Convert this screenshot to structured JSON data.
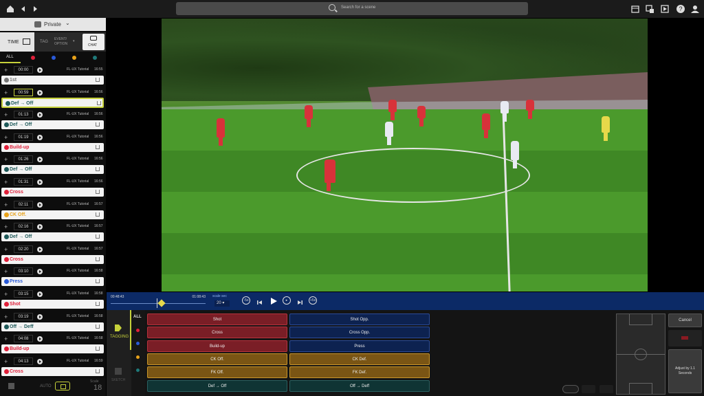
{
  "search": {
    "placeholder": "Search for a scene"
  },
  "header": {
    "icons": [
      "home-icon",
      "back-icon",
      "forward-icon",
      "calendar-icon",
      "export-icon",
      "playlist-icon",
      "help-icon",
      "account-icon"
    ]
  },
  "sidebar": {
    "visibility": "Private",
    "tabs": {
      "time": "TIME",
      "tag": "TAG",
      "event_option": "EVENT/ OPTION",
      "chat": "CHAT"
    },
    "filter_all": "ALL",
    "filter_colors": [
      "#e0203a",
      "#2a5ad8",
      "#e8a21a",
      "#1f7a7a"
    ],
    "entries": [
      {
        "time": "00:00",
        "author": "FL-UX Tutorial",
        "clock": "16:55",
        "label": "1st",
        "color": "#777777",
        "selected": false
      },
      {
        "time": "00:59",
        "author": "FL-UX Tutorial",
        "clock": "16:56",
        "label": "Def → Off",
        "color": "#1f5a5a",
        "selected": true
      },
      {
        "time": "01:13",
        "author": "FL-UX Tutorial",
        "clock": "16:56",
        "label": "Def → Off",
        "color": "#1f5a5a",
        "selected": false
      },
      {
        "time": "01:19",
        "author": "FL-UX Tutorial",
        "clock": "16:56",
        "label": "Build-up",
        "color": "#e0203a",
        "selected": false
      },
      {
        "time": "01:26",
        "author": "FL-UX Tutorial",
        "clock": "16:56",
        "label": "Def → Off",
        "color": "#1f5a5a",
        "selected": false
      },
      {
        "time": "01:31",
        "author": "FL-UX Tutorial",
        "clock": "16:56",
        "label": "Cross",
        "color": "#e0203a",
        "selected": false
      },
      {
        "time": "02:11",
        "author": "FL-UX Tutorial",
        "clock": "16:57",
        "label": "CK Off.",
        "color": "#e8a21a",
        "selected": false
      },
      {
        "time": "02:16",
        "author": "FL-UX Tutorial",
        "clock": "16:57",
        "label": "Def → Off",
        "color": "#1f5a5a",
        "selected": false
      },
      {
        "time": "02:20",
        "author": "FL-UX Tutorial",
        "clock": "16:57",
        "label": "Cross",
        "color": "#e0203a",
        "selected": false
      },
      {
        "time": "03:10",
        "author": "FL-UX Tutorial",
        "clock": "16:58",
        "label": "Press",
        "color": "#2a5ad8",
        "selected": false
      },
      {
        "time": "03:15",
        "author": "FL-UX Tutorial",
        "clock": "16:58",
        "label": "Shot",
        "color": "#e0203a",
        "selected": false
      },
      {
        "time": "03:19",
        "author": "FL-UX Tutorial",
        "clock": "16:58",
        "label": "Off → Deff",
        "color": "#1f5a5a",
        "selected": false
      },
      {
        "time": "04:08",
        "author": "FL-UX Tutorial",
        "clock": "16:58",
        "label": "Build-up",
        "color": "#e0203a",
        "selected": false
      },
      {
        "time": "04:13",
        "author": "FL-UX Tutorial",
        "clock": "16:59",
        "label": "Cross",
        "color": "#e0203a",
        "selected": false
      }
    ],
    "footer": {
      "auto": "AUTO",
      "scale_label": "Scale",
      "scale_value": "18"
    }
  },
  "transport": {
    "start": "00:48:43",
    "end": "01:08:43",
    "scale_label": "scale sec",
    "scale_value": "20",
    "skip_back_label": "-5s",
    "skip_fwd_label": "+5s",
    "position": 0.5
  },
  "tagging": {
    "side_tagging": "TAGGING",
    "side_sketch": "SKETCH",
    "all": "ALL",
    "buttons": [
      {
        "label": "Shot",
        "style": "rd"
      },
      {
        "label": "Shot Opp.",
        "style": "bl"
      },
      {
        "label": "Cross",
        "style": "rd"
      },
      {
        "label": "Cross Opp.",
        "style": "bl"
      },
      {
        "label": "Build-up",
        "style": "rd"
      },
      {
        "label": "Press",
        "style": "bl"
      },
      {
        "label": "CK Off.",
        "style": "yl"
      },
      {
        "label": "CK Def.",
        "style": "yl"
      },
      {
        "label": "FK Off.",
        "style": "yl"
      },
      {
        "label": "FK Def.",
        "style": "yl"
      },
      {
        "label": "Def → Off",
        "style": "dg"
      },
      {
        "label": "Off → Deff",
        "style": "dg"
      }
    ],
    "cancel": "Cancel",
    "adjust": "Adjust by 1.1 Seconds"
  }
}
